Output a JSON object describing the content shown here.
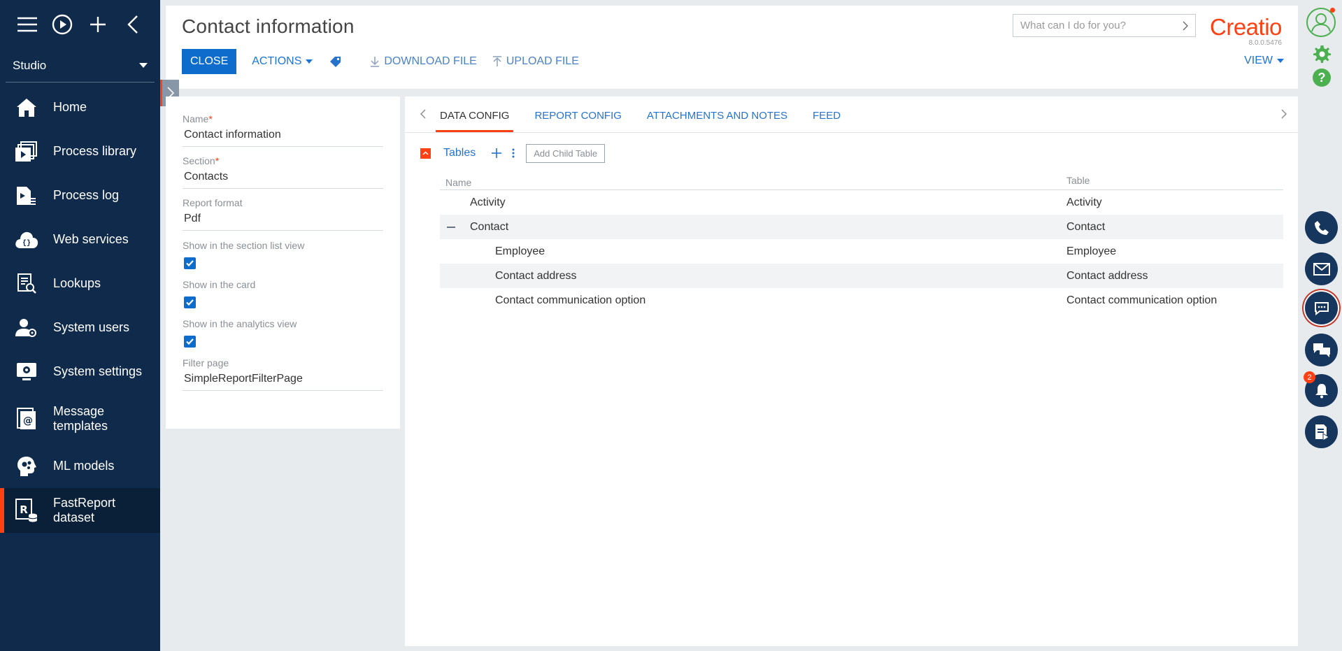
{
  "sidebar": {
    "workspace": "Studio",
    "items": [
      {
        "label": "Home",
        "icon": "home-icon"
      },
      {
        "label": "Process library",
        "icon": "process-library-icon"
      },
      {
        "label": "Process log",
        "icon": "process-log-icon"
      },
      {
        "label": "Web services",
        "icon": "web-services-icon"
      },
      {
        "label": "Lookups",
        "icon": "lookups-icon"
      },
      {
        "label": "System users",
        "icon": "system-users-icon"
      },
      {
        "label": "System settings",
        "icon": "system-settings-icon"
      },
      {
        "label": "Message\ntemplates",
        "icon": "message-templates-icon"
      },
      {
        "label": "ML models",
        "icon": "ml-models-icon"
      },
      {
        "label": "FastReport\ndataset",
        "icon": "fastreport-dataset-icon",
        "active": true
      }
    ]
  },
  "header": {
    "title": "Contact information",
    "close_label": "CLOSE",
    "actions_label": "ACTIONS",
    "download_label": "DOWNLOAD FILE",
    "upload_label": "UPLOAD FILE",
    "view_label": "VIEW",
    "search_placeholder": "What can I do for you?",
    "brand": "Creatio",
    "version": "8.0.0.5476"
  },
  "form": {
    "name_label": "Name",
    "name_value": "Contact information",
    "section_label": "Section",
    "section_value": "Contacts",
    "format_label": "Report format",
    "format_value": "Pdf",
    "show_section_label": "Show in the section list view",
    "show_card_label": "Show in the card",
    "show_analytics_label": "Show in the analytics view",
    "filter_label": "Filter page",
    "filter_value": "SimpleReportFilterPage"
  },
  "tabs": [
    "DATA CONFIG",
    "REPORT CONFIG",
    "ATTACHMENTS AND NOTES",
    "FEED"
  ],
  "tables": {
    "label": "Tables",
    "add_child_label": "Add Child Table",
    "col_name": "Name",
    "col_table": "Table",
    "rows": [
      {
        "name": "Activity",
        "table": "Activity",
        "level": 1
      },
      {
        "name": "Contact",
        "table": "Contact",
        "level": 1,
        "expanded": true
      },
      {
        "name": "Employee",
        "table": "Employee",
        "level": 2
      },
      {
        "name": "Contact address",
        "table": "Contact address",
        "level": 2
      },
      {
        "name": "Contact communication option",
        "table": "Contact communication option",
        "level": 2
      }
    ]
  },
  "rail": {
    "notification_count": "2"
  },
  "colors": {
    "sidebar": "#0f2a4a",
    "accent": "#ff4013",
    "primary": "#0e6ccd",
    "link": "#2573cd"
  }
}
